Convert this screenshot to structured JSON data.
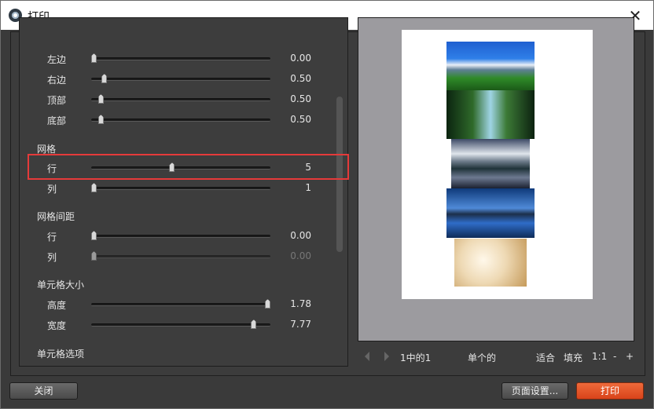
{
  "window": {
    "title": "打印"
  },
  "settings": {
    "margins": [
      {
        "label": "左边",
        "value": "0.00",
        "level": 0.0
      },
      {
        "label": "右边",
        "value": "0.50",
        "level": 0.06
      },
      {
        "label": "顶部",
        "value": "0.50",
        "level": 0.04
      },
      {
        "label": "底部",
        "value": "0.50",
        "level": 0.04
      }
    ],
    "grid": {
      "heading": "网格",
      "rows": [
        {
          "label": "行",
          "value": "5",
          "level": 0.45
        },
        {
          "label": "列",
          "value": "1",
          "level": 0.0
        }
      ]
    },
    "grid_spacing": {
      "heading": "网格间距",
      "rows": [
        {
          "label": "行",
          "value": "0.00",
          "level": 0.0
        },
        {
          "label": "列",
          "value": "0.00",
          "level": 0.0,
          "disabled": true
        }
      ]
    },
    "cell_size": {
      "heading": "单元格大小",
      "rows": [
        {
          "label": "高度",
          "value": "1.78",
          "level": 1.0
        },
        {
          "label": "宽度",
          "value": "7.77",
          "level": 0.92
        }
      ]
    },
    "cell_options": {
      "heading": "单元格选项"
    }
  },
  "preview": {
    "nav": {
      "page_label": "1中的1",
      "mode_label": "单个的",
      "fit_label": "适合",
      "fill_label": "填充",
      "ratio_label": "1:1",
      "zoom_out": "-",
      "zoom_in": "+"
    }
  },
  "buttons": {
    "close": "关闭",
    "page_setup": "页面设置...",
    "print": "打印"
  },
  "colors": {
    "accent": "#e0501f",
    "highlight": "#e53a3a"
  }
}
